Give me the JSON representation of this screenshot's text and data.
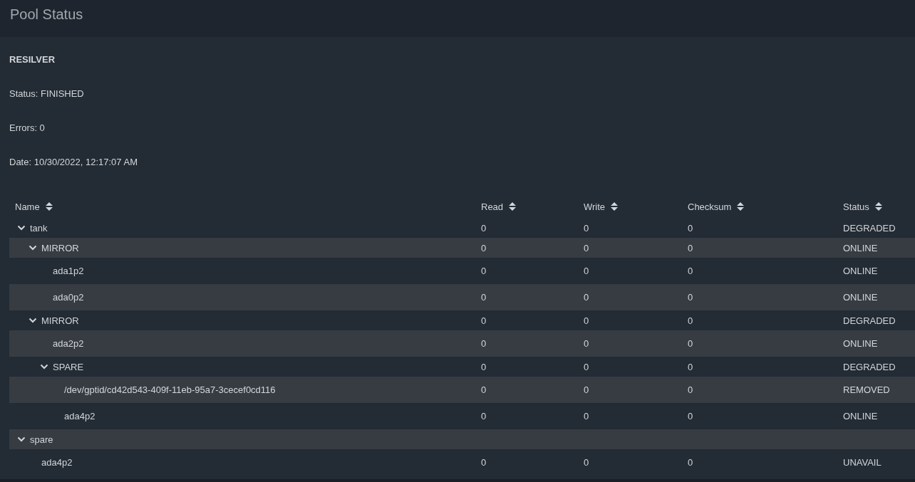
{
  "title": "Pool Status",
  "scan": {
    "heading": "RESILVER",
    "lines": [
      "Status: FINISHED",
      "Errors: 0",
      "Date: 10/30/2022, 12:17:07 AM"
    ]
  },
  "table": {
    "columns": [
      "Name",
      "Read",
      "Write",
      "Checksum",
      "Status"
    ],
    "rows": [
      {
        "name": "tank",
        "read": "0",
        "write": "0",
        "checksum": "0",
        "status": "DEGRADED",
        "expanded": true,
        "children": [
          {
            "name": "MIRROR",
            "read": "0",
            "write": "0",
            "checksum": "0",
            "status": "ONLINE",
            "expanded": true,
            "children": [
              {
                "name": "ada1p2",
                "read": "0",
                "write": "0",
                "checksum": "0",
                "status": "ONLINE"
              },
              {
                "name": "ada0p2",
                "read": "0",
                "write": "0",
                "checksum": "0",
                "status": "ONLINE"
              }
            ]
          },
          {
            "name": "MIRROR",
            "read": "0",
            "write": "0",
            "checksum": "0",
            "status": "DEGRADED",
            "expanded": true,
            "children": [
              {
                "name": "ada2p2",
                "read": "0",
                "write": "0",
                "checksum": "0",
                "status": "ONLINE"
              },
              {
                "name": "SPARE",
                "read": "0",
                "write": "0",
                "checksum": "0",
                "status": "DEGRADED",
                "expanded": true,
                "children": [
                  {
                    "name": "/dev/gptid/cd42d543-409f-11eb-95a7-3cecef0cd116",
                    "read": "0",
                    "write": "0",
                    "checksum": "0",
                    "status": "REMOVED"
                  },
                  {
                    "name": "ada4p2",
                    "read": "0",
                    "write": "0",
                    "checksum": "0",
                    "status": "ONLINE"
                  }
                ]
              }
            ]
          }
        ]
      },
      {
        "name": "spare",
        "expanded": true,
        "children": [
          {
            "name": "ada4p2",
            "read": "0",
            "write": "0",
            "checksum": "0",
            "status": "UNAVAIL"
          }
        ]
      }
    ]
  }
}
